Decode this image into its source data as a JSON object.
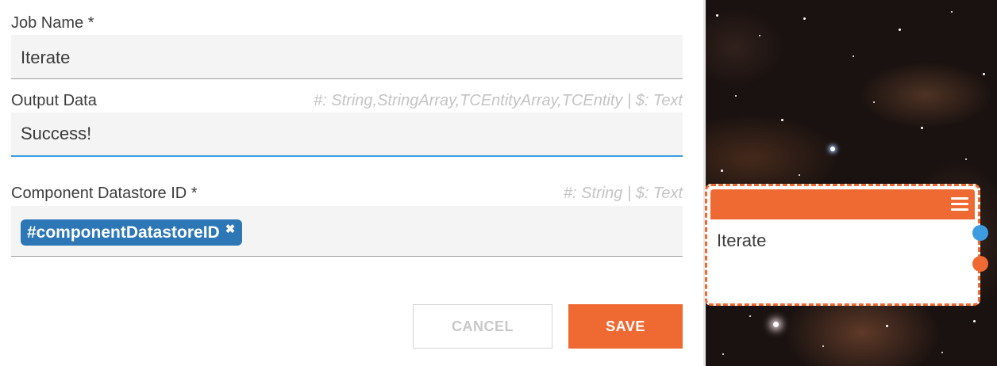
{
  "job_name": {
    "label": "Job Name *",
    "value": "Iterate"
  },
  "output_data": {
    "label": "Output Data",
    "hint": "#: String,StringArray,TCEntityArray,TCEntity  |  $: Text",
    "value": "Success!"
  },
  "datastore_id": {
    "label": "Component Datastore ID *",
    "hint": "#: String  |  $: Text",
    "chip": "#componentDatastoreID",
    "chip_remove": "✖"
  },
  "actions": {
    "cancel": "CANCEL",
    "save": "SAVE"
  },
  "node": {
    "title": "Iterate"
  },
  "colors": {
    "accent": "#ef6a32",
    "focus": "#3d9be0",
    "chip": "#2d77b7"
  }
}
